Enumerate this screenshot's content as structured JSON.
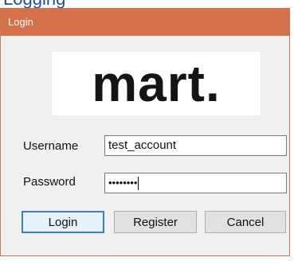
{
  "background": {
    "partial_heading": "Logging"
  },
  "window": {
    "title": "Login"
  },
  "logo": {
    "text": "mart."
  },
  "form": {
    "username_label": "Username",
    "username_value": "test_account",
    "password_label": "Password",
    "password_value": "••••••••"
  },
  "buttons": {
    "login": "Login",
    "register": "Register",
    "cancel": "Cancel"
  },
  "colors": {
    "titlebar": "#d4714b",
    "dialog_bg": "#f0f0f0",
    "focus_border": "#3a7bd5"
  }
}
